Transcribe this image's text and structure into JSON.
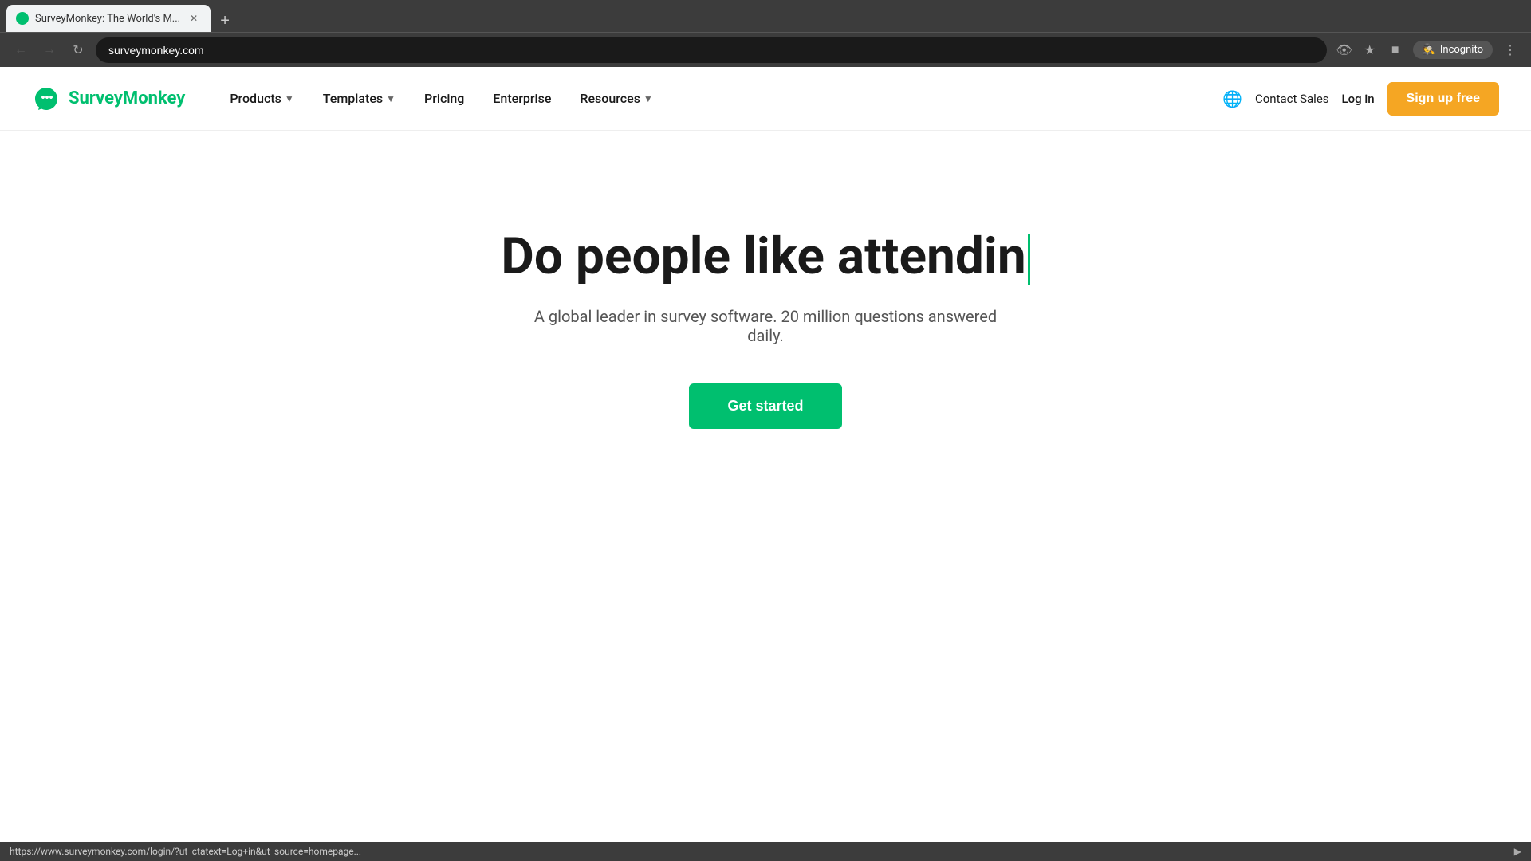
{
  "browser": {
    "tab_title": "SurveyMonkey: The World's M...",
    "tab_favicon": "SM",
    "address": "surveymonkey.com",
    "new_tab_label": "+",
    "incognito_label": "Incognito",
    "status_url": "https://www.surveymonkey.com/login/?ut_ctatext=Log+in&ut_source=homepage..."
  },
  "nav": {
    "logo_text": "SurveyMonkey",
    "items": [
      {
        "label": "Products",
        "has_dropdown": true
      },
      {
        "label": "Templates",
        "has_dropdown": true
      },
      {
        "label": "Pricing",
        "has_dropdown": false
      },
      {
        "label": "Enterprise",
        "has_dropdown": false
      },
      {
        "label": "Resources",
        "has_dropdown": true
      }
    ],
    "contact_sales": "Contact Sales",
    "login": "Log in",
    "signup": "Sign up free"
  },
  "hero": {
    "title": "Do people like attendin",
    "cursor_visible": true,
    "subtitle": "A global leader in survey software. 20 million questions answered daily.",
    "cta_label": "Get started"
  }
}
